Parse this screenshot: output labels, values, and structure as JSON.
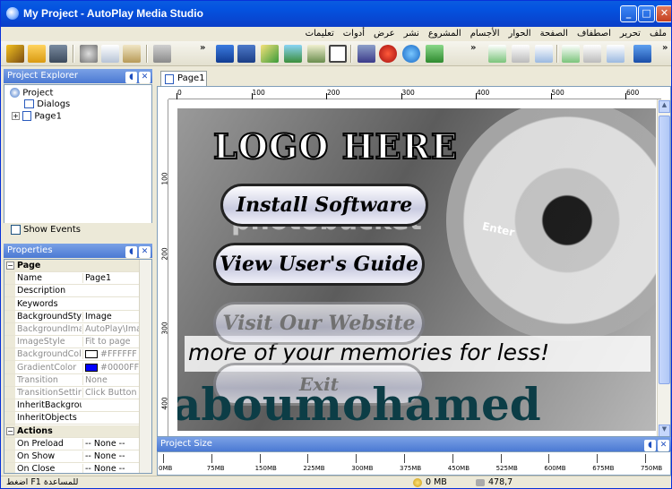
{
  "window": {
    "title": "My Project - AutoPlay Media Studio",
    "min": "_",
    "max": "□",
    "close": "✕"
  },
  "menu": [
    "ملف",
    "تحرير",
    "اصطفاف",
    "الصفحة",
    "الحوار",
    "الأجسام",
    "المشروع",
    "نشر",
    "عرض",
    "أدوات",
    "تعليمات"
  ],
  "explorer": {
    "title": "Project Explorer",
    "root": "Project",
    "dialogs": "Dialogs",
    "page": "Page1",
    "show_events": "Show Events"
  },
  "properties": {
    "title": "Properties",
    "sections": [
      {
        "cat": "Page",
        "rows": [
          {
            "k": "Name",
            "v": "Page1",
            "gray": false
          },
          {
            "k": "Description",
            "v": "",
            "gray": false
          },
          {
            "k": "Keywords",
            "v": "",
            "gray": false
          },
          {
            "k": "BackgroundStyle",
            "v": "Image",
            "gray": false
          },
          {
            "k": "BackgroundImage",
            "v": "AutoPlay\\Image",
            "gray": true
          },
          {
            "k": "ImageStyle",
            "v": "Fit to page",
            "gray": true
          },
          {
            "k": "BackgroundColor",
            "v": "#FFFFFF",
            "gray": true
          },
          {
            "k": "GradientColor",
            "v": "#0000FF",
            "gray": true
          },
          {
            "k": "Transition",
            "v": "None",
            "gray": true
          },
          {
            "k": "TransitionSettings",
            "v": "Click Button",
            "gray": true
          },
          {
            "k": "InheritBackground",
            "v": "",
            "gray": false
          },
          {
            "k": "InheritObjects",
            "v": "",
            "gray": false
          }
        ]
      },
      {
        "cat": "Actions",
        "rows": [
          {
            "k": "On Preload",
            "v": "-- None --",
            "gray": false
          },
          {
            "k": "On Show",
            "v": "-- None --",
            "gray": false
          },
          {
            "k": "On Close",
            "v": "-- None --",
            "gray": false
          }
        ]
      }
    ],
    "colors": {
      "bg": "#FFFFFF",
      "grad": "#0000FF"
    }
  },
  "tab": {
    "label": "Page1"
  },
  "ruler": {
    "h": [
      "0",
      "100",
      "200",
      "300",
      "400",
      "500",
      "600"
    ],
    "v": [
      "100",
      "200",
      "300",
      "400"
    ]
  },
  "page": {
    "logo": "LOGO HERE",
    "buttons": [
      "Install Software",
      "View User's Guide",
      "Visit Our Website",
      "Exit"
    ],
    "tagline": "more of your memories for less!",
    "watermark": "photobucket",
    "overlay": "aboumohamed",
    "key": "Enter"
  },
  "project_size": {
    "title": "Project Size",
    "ticks": [
      "0MB",
      "75MB",
      "150MB",
      "225MB",
      "300MB",
      "375MB",
      "450MB",
      "525MB",
      "600MB",
      "675MB",
      "750MB"
    ]
  },
  "status": {
    "help": "اضغط F1 للمساعدة",
    "size": "0 MB",
    "zoom": "478,7"
  }
}
